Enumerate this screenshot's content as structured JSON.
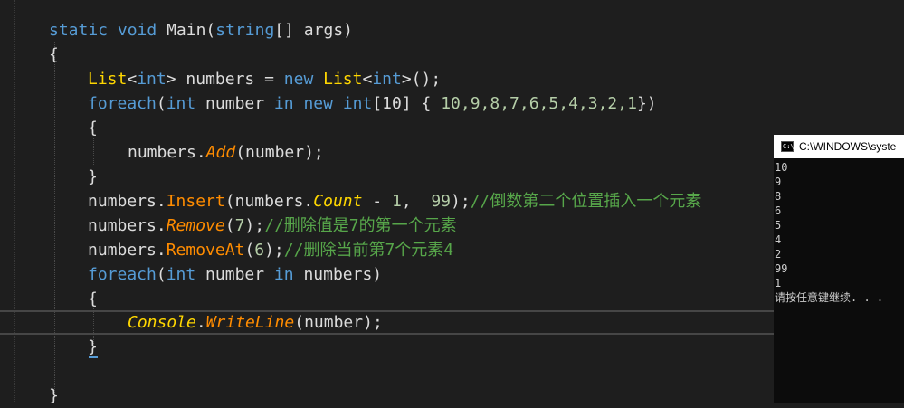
{
  "editor": {
    "lines": [
      {
        "segments": [
          {
            "t": "static",
            "c": "kw"
          },
          {
            "t": " ",
            "c": "id"
          },
          {
            "t": "void",
            "c": "kw"
          },
          {
            "t": " Main(",
            "c": "id"
          },
          {
            "t": "string",
            "c": "kw"
          },
          {
            "t": "[] args)",
            "c": "id"
          }
        ]
      },
      {
        "segments": [
          {
            "t": "{",
            "c": "id"
          }
        ]
      },
      {
        "segments": [
          {
            "t": "List",
            "c": "yel"
          },
          {
            "t": "<",
            "c": "id"
          },
          {
            "t": "int",
            "c": "kw"
          },
          {
            "t": "> numbers = ",
            "c": "id"
          },
          {
            "t": "new",
            "c": "kw"
          },
          {
            "t": " ",
            "c": "id"
          },
          {
            "t": "List",
            "c": "yel"
          },
          {
            "t": "<",
            "c": "id"
          },
          {
            "t": "int",
            "c": "kw"
          },
          {
            "t": ">();",
            "c": "id"
          }
        ]
      },
      {
        "segments": [
          {
            "t": "foreach",
            "c": "kw"
          },
          {
            "t": "(",
            "c": "id"
          },
          {
            "t": "int",
            "c": "kw"
          },
          {
            "t": " number ",
            "c": "id"
          },
          {
            "t": "in",
            "c": "kw"
          },
          {
            "t": " ",
            "c": "id"
          },
          {
            "t": "new",
            "c": "kw"
          },
          {
            "t": " ",
            "c": "id"
          },
          {
            "t": "int",
            "c": "kw"
          },
          {
            "t": "[10] { ",
            "c": "id"
          },
          {
            "t": "10,9,8,7,6,5,4,3,2,1",
            "c": "num"
          },
          {
            "t": "})",
            "c": "id"
          }
        ]
      },
      {
        "segments": [
          {
            "t": "{",
            "c": "id"
          }
        ]
      },
      {
        "segments": [
          {
            "t": "numbers.",
            "c": "id"
          },
          {
            "t": "Add",
            "c": "orn it"
          },
          {
            "t": "(number);",
            "c": "id"
          }
        ]
      },
      {
        "segments": [
          {
            "t": "}",
            "c": "id"
          }
        ]
      },
      {
        "segments": [
          {
            "t": "numbers.",
            "c": "id"
          },
          {
            "t": "Insert",
            "c": "orn"
          },
          {
            "t": "(numbers.",
            "c": "id"
          },
          {
            "t": "Count",
            "c": "yel it"
          },
          {
            "t": " - ",
            "c": "id"
          },
          {
            "t": "1",
            "c": "num"
          },
          {
            "t": ",  ",
            "c": "id"
          },
          {
            "t": "99",
            "c": "num"
          },
          {
            "t": ");",
            "c": "id"
          },
          {
            "t": "//倒数第二个位置插入一个元素",
            "c": "cm"
          }
        ]
      },
      {
        "segments": [
          {
            "t": "numbers.",
            "c": "id"
          },
          {
            "t": "Remove",
            "c": "orn it"
          },
          {
            "t": "(",
            "c": "id"
          },
          {
            "t": "7",
            "c": "num"
          },
          {
            "t": ");",
            "c": "id"
          },
          {
            "t": "//删除值是7的第一个元素",
            "c": "cm"
          }
        ]
      },
      {
        "segments": [
          {
            "t": "numbers.",
            "c": "id"
          },
          {
            "t": "RemoveAt",
            "c": "orn"
          },
          {
            "t": "(",
            "c": "id"
          },
          {
            "t": "6",
            "c": "num"
          },
          {
            "t": ");",
            "c": "id"
          },
          {
            "t": "//删除当前第7个元素4",
            "c": "cm"
          }
        ]
      },
      {
        "segments": [
          {
            "t": "foreach",
            "c": "kw"
          },
          {
            "t": "(",
            "c": "id"
          },
          {
            "t": "int",
            "c": "kw"
          },
          {
            "t": " number ",
            "c": "id"
          },
          {
            "t": "in",
            "c": "kw"
          },
          {
            "t": " numbers)",
            "c": "id"
          }
        ]
      },
      {
        "segments": [
          {
            "t": "{",
            "c": "id"
          }
        ]
      },
      {
        "segments": [
          {
            "t": "Console",
            "c": "yel it"
          },
          {
            "t": ".",
            "c": "id"
          },
          {
            "t": "WriteLine",
            "c": "orn it"
          },
          {
            "t": "(number);",
            "c": "id"
          }
        ]
      },
      {
        "segments": [
          {
            "t": "}",
            "c": "id"
          }
        ]
      },
      {
        "segments": []
      },
      {
        "segments": [
          {
            "t": "}",
            "c": "id"
          }
        ]
      }
    ]
  },
  "console": {
    "title": "C:\\WINDOWS\\syste",
    "icon": "console-window-icon",
    "icon_glyph": "C:\\",
    "output": [
      "10",
      "9",
      "8",
      "6",
      "5",
      "4",
      "2",
      "99",
      "1",
      "请按任意键继续. . ."
    ]
  },
  "colors": {
    "background": "#1e1e1e",
    "keyword": "#569cd6",
    "comment": "#57a64a",
    "number": "#b5cea8",
    "console_bg": "#0c0c0c"
  }
}
